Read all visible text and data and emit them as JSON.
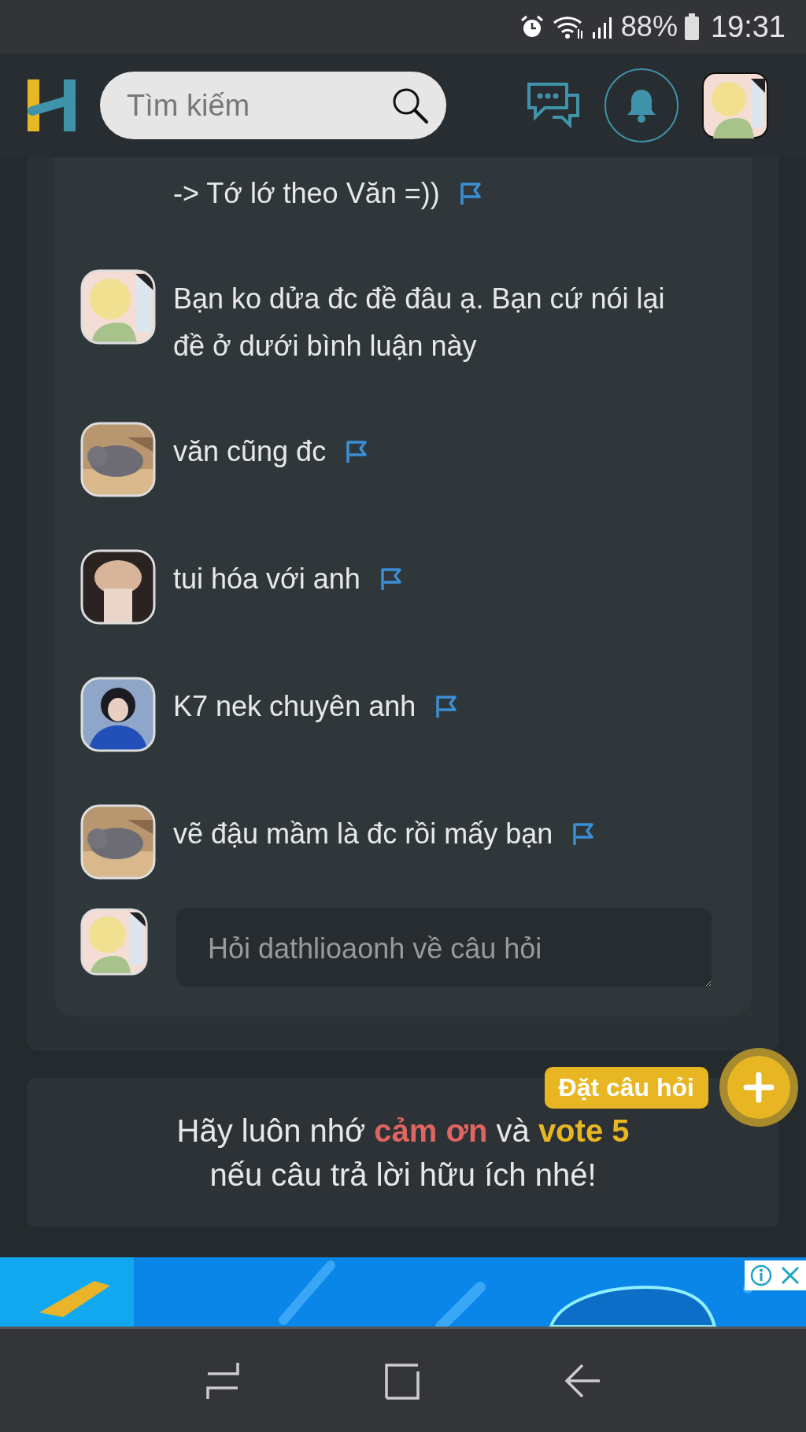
{
  "status_bar": {
    "battery": "88%",
    "time": "19:31"
  },
  "header": {
    "search": {
      "placeholder": "Tìm kiếm"
    }
  },
  "comments": [
    {
      "text": "-> Tớ lớ theo Văn =))",
      "flag": true,
      "avatar_visible": false
    },
    {
      "text": "Bạn ko dửa đc đề đâu ạ. Bạn cứ nói lại đề ở dưới bình luận này",
      "flag": false,
      "avatar_visible": true
    },
    {
      "text": "văn cũng đc",
      "flag": true,
      "avatar_visible": true
    },
    {
      "text": "tui hóa với anh",
      "flag": true,
      "avatar_visible": true
    },
    {
      "text": "K7 nek chuyên anh",
      "flag": true,
      "avatar_visible": true
    },
    {
      "text": "vẽ đậu mầm là đc rồi mấy bạn",
      "flag": true,
      "avatar_visible": true
    }
  ],
  "reply_box": {
    "placeholder": "Hỏi dathlioaonh về câu hỏi"
  },
  "reminder": {
    "text": "Hãy luôn nhớ **cảm ơn** và **vote 5** nếu câu trả lời hữu ích nhé!"
  },
  "ask_button": {
    "label": "Đặt câu hỏi"
  }
}
